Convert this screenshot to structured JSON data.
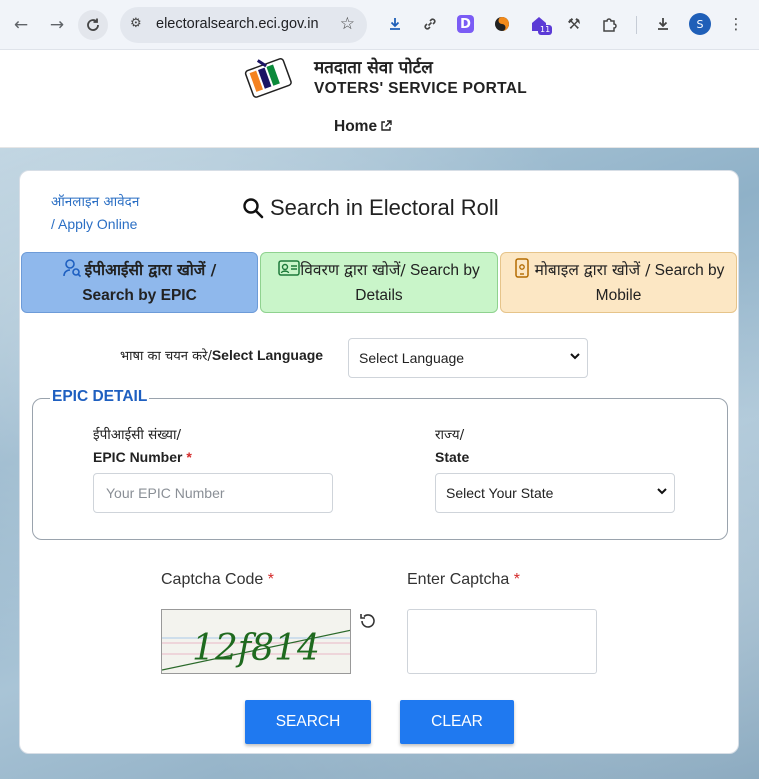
{
  "browser": {
    "url": "electoralsearch.eci.gov.in",
    "profile_initial": "S",
    "ext_d_label": "D",
    "ext_badge": "11",
    "icons": [
      "back-arrow-icon",
      "forward-arrow-icon",
      "reload-icon",
      "site-info-icon",
      "bookmark-star-icon",
      "download-icon",
      "link-icon",
      "d-extension-icon",
      "swirl-extension-icon",
      "house-extension-icon",
      "hammer-pick-icon",
      "puzzle-extensions-icon",
      "downloads-icon",
      "profile-avatar",
      "menu-dots-icon"
    ]
  },
  "header": {
    "title_hindi": "मतदाता सेवा पोर्टल",
    "title_english": "VOTERS' SERVICE PORTAL",
    "home_label": "Home"
  },
  "card": {
    "apply_online_hindi": "ऑनलाइन आवेदन",
    "apply_online_english": "/ Apply Online",
    "title": "Search in Electoral Roll",
    "tabs": [
      {
        "hindi": "ईपीआईसी द्वारा खोजें /",
        "english": "Search by EPIC",
        "active": true
      },
      {
        "hindi": "विवरण द्वारा खोजें/",
        "english_part1": "Search by",
        "english_part2": "Details",
        "active": false
      },
      {
        "hindi": "मोबाइल द्वारा खोजें /",
        "english_part1": "Search by",
        "english_part2": "Mobile",
        "active": false
      }
    ],
    "language": {
      "label_hindi": "भाषा का चयन करे/",
      "label_english": "Select Language",
      "selected": "Select Language"
    },
    "epic_detail": {
      "legend": "EPIC DETAIL",
      "epic_label_hindi": "ईपीआईसी संख्या/",
      "epic_label_english": "EPIC Number",
      "epic_placeholder": "Your EPIC Number",
      "state_label_hindi": "राज्य/",
      "state_label_english": "State",
      "state_selected": "Select Your State"
    },
    "captcha": {
      "label": "Captcha Code",
      "enter_label": "Enter Captcha",
      "code_text": "12f814",
      "required_mark": "*"
    },
    "buttons": {
      "search": "SEARCH",
      "clear": "CLEAR"
    }
  },
  "colors": {
    "primary_button": "#1f79f0",
    "tab_epic": "#8fb8ec",
    "tab_details": "#c9f5c9",
    "tab_mobile": "#fce7c4",
    "legend_blue": "#1e5fc0",
    "required_red": "#d42a2a"
  }
}
